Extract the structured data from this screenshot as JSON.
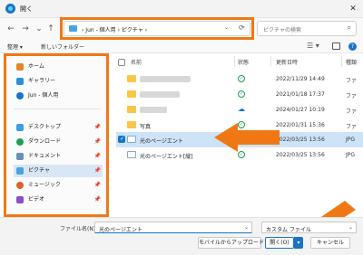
{
  "window": {
    "title": "開く",
    "close_glyph": "✕"
  },
  "nav": {
    "back": "←",
    "forward": "→",
    "up_menu": "⌄",
    "up": "↑"
  },
  "address": {
    "crumbs": "›   Jun - 個人用   ›   ピクチャ   ›",
    "dropdown": "⌄",
    "refresh": "⟳"
  },
  "search": {
    "placeholder": "ピクチャの検索",
    "icon": "⌕"
  },
  "toolbar": {
    "organize": "整理 ▾",
    "new_folder": "新しいフォルダー",
    "view_icon": "☰ ▾"
  },
  "sidebar": {
    "items": [
      {
        "label": "ホーム",
        "icon": "home-icon",
        "pinned": false
      },
      {
        "label": "ギャラリー",
        "icon": "gallery-icon",
        "pinned": false
      },
      {
        "label": "Jun - 個人用",
        "icon": "onedrive-icon",
        "pinned": false
      },
      {
        "label": "デスクトップ",
        "icon": "desktop-icon",
        "pinned": true
      },
      {
        "label": "ダウンロード",
        "icon": "download-icon",
        "pinned": true
      },
      {
        "label": "ドキュメント",
        "icon": "documents-icon",
        "pinned": true
      },
      {
        "label": "ピクチャ",
        "icon": "pictures-icon",
        "pinned": true,
        "selected": true
      },
      {
        "label": "ミュージック",
        "icon": "music-icon",
        "pinned": true
      },
      {
        "label": "ビデオ",
        "icon": "video-icon",
        "pinned": true
      }
    ],
    "pin_glyph": "📌"
  },
  "columns": {
    "name": "名前",
    "status": "状態",
    "modified": "更新日時",
    "type": "種類"
  },
  "files": [
    {
      "name": "",
      "kind": "folder",
      "status": "✓",
      "date": "2022/11/29 14:49",
      "type": "ファ",
      "blurred": true
    },
    {
      "name": "",
      "kind": "folder",
      "status": "✓",
      "date": "2021/01/18 17:37",
      "type": "ファ",
      "blurred": true
    },
    {
      "name": "",
      "kind": "folder",
      "status": "☁",
      "date": "2024/01/27 10:19",
      "type": "ファ",
      "blurred": true
    },
    {
      "name": "写真",
      "kind": "folder",
      "status": "✓",
      "date": "2022/01/31 15:36",
      "type": "ファ"
    },
    {
      "name": "光のページエント",
      "kind": "image",
      "status": "✓",
      "date": "2022/03/25 13:56",
      "type": "JPG",
      "selected": true
    },
    {
      "name": "光のページエント[縦]",
      "kind": "image",
      "status": "✓",
      "date": "2022/03/25 13:56",
      "type": "JPG"
    }
  ],
  "footer": {
    "filename_label": "ファイル名(N):",
    "filename_value": "光のページエント",
    "filter_value": "カスタム ファイル",
    "mobile_button": "モバイルからアップロード",
    "open_button": "開く(O)",
    "cancel_button": "キャンセル"
  },
  "colors": {
    "accent": "#1a73c9",
    "highlight": "#f07814",
    "folder": "#f7c64a"
  }
}
